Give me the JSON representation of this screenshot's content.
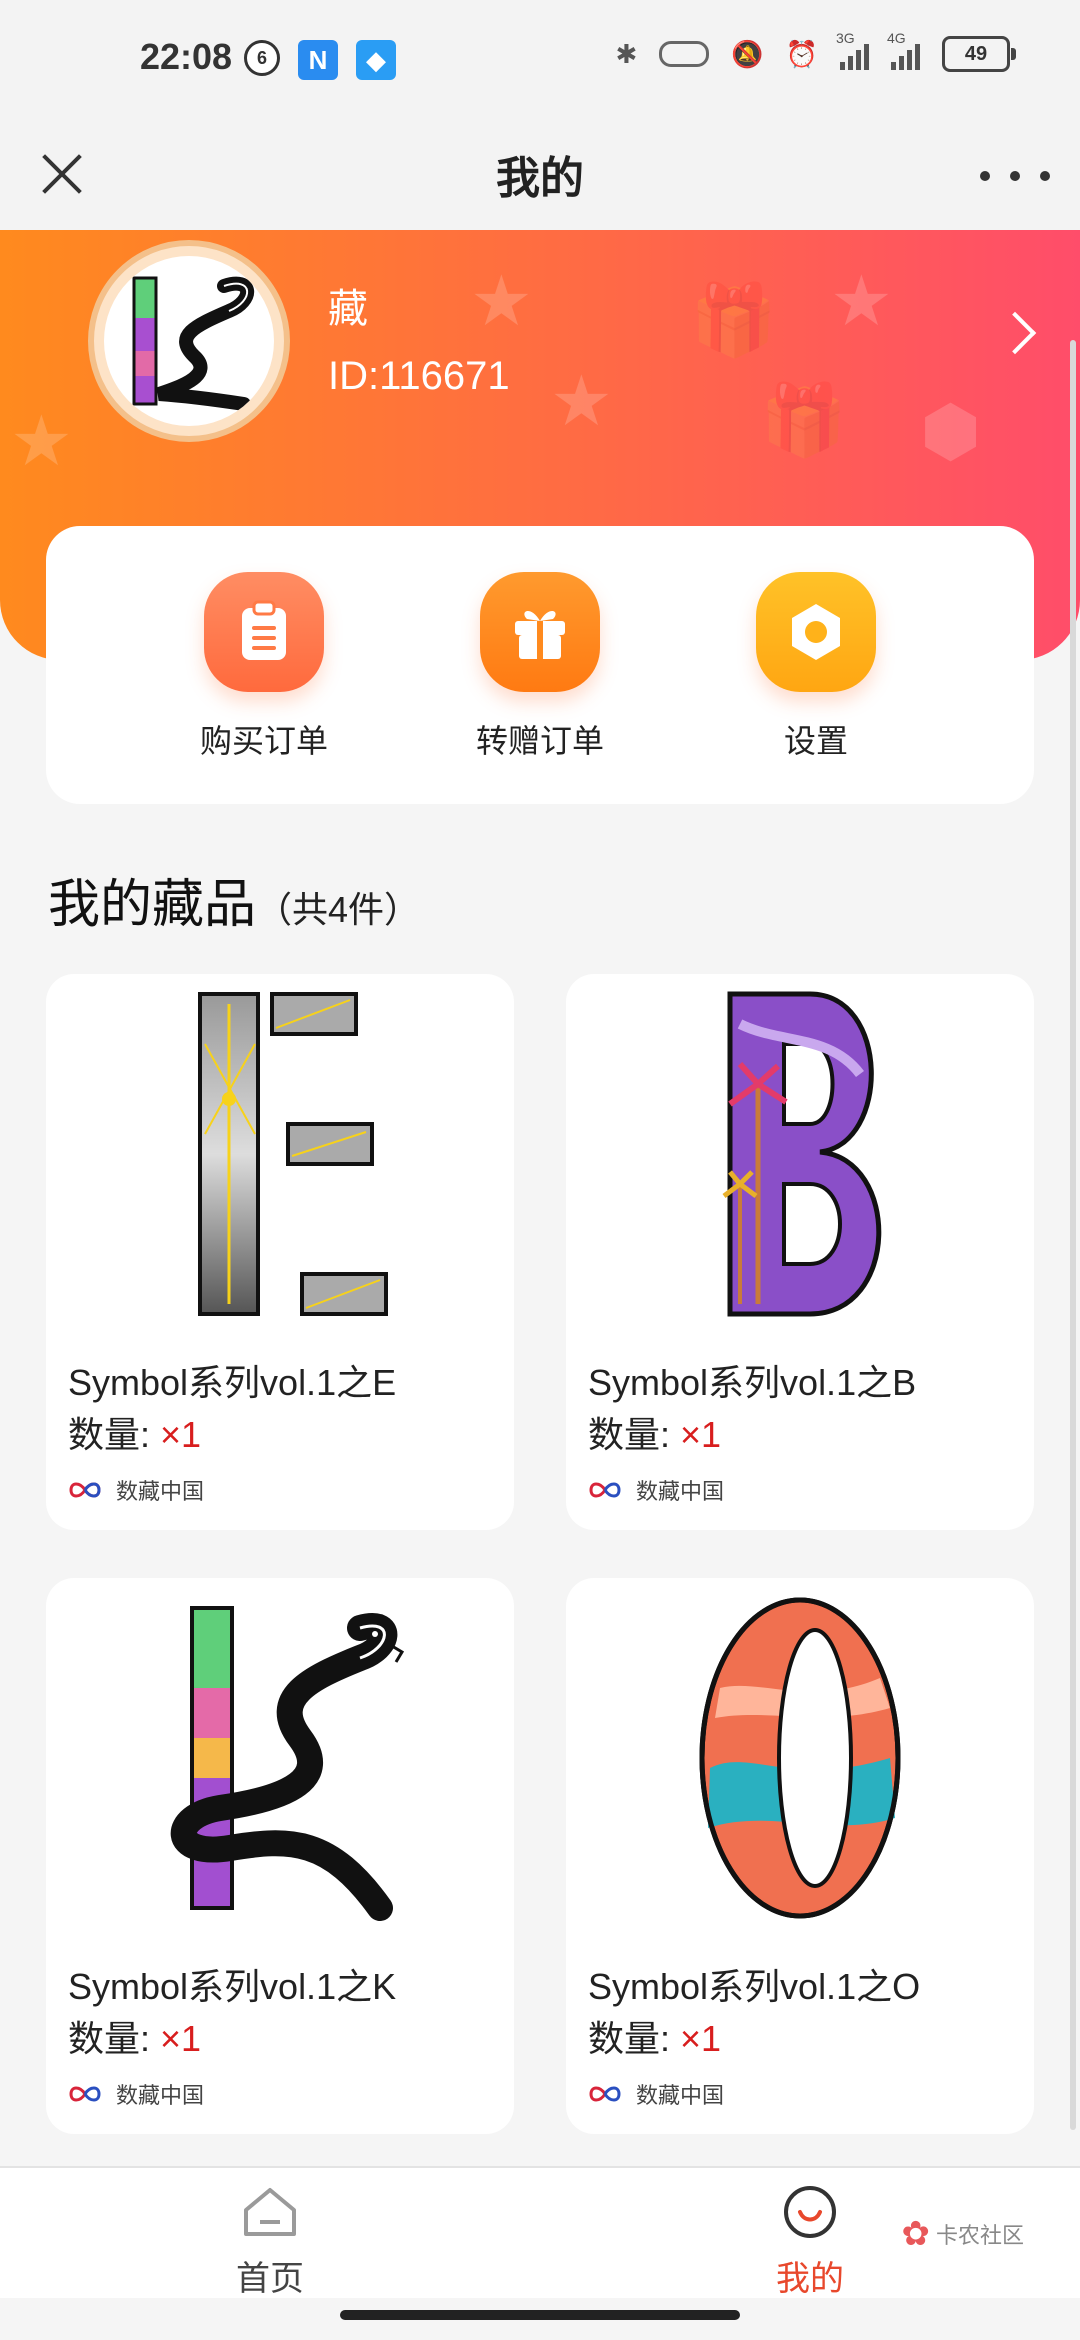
{
  "status": {
    "time": "22:08",
    "battery": "49",
    "net1": "3G",
    "net2": "4G"
  },
  "titlebar": {
    "title": "我的"
  },
  "profile": {
    "name": "藏",
    "id": "ID:116671"
  },
  "actions": [
    {
      "label": "购买订单",
      "icon": "clipboard-icon",
      "color": "#ff7a45"
    },
    {
      "label": "转赠订单",
      "icon": "gift-icon",
      "color": "#ff8a1e"
    },
    {
      "label": "设置",
      "icon": "hex-nut-icon",
      "color": "#ffb21a"
    }
  ],
  "collection": {
    "title": "我的藏品",
    "count": "（共4件）",
    "items": [
      {
        "name": "Symbol系列vol.1之E",
        "qty_label": "数量:",
        "qty": "×1",
        "brand": "数藏中国"
      },
      {
        "name": "Symbol系列vol.1之B",
        "qty_label": "数量:",
        "qty": "×1",
        "brand": "数藏中国"
      },
      {
        "name": "Symbol系列vol.1之K",
        "qty_label": "数量:",
        "qty": "×1",
        "brand": "数藏中国"
      },
      {
        "name": "Symbol系列vol.1之O",
        "qty_label": "数量:",
        "qty": "×1",
        "brand": "数藏中国"
      }
    ]
  },
  "nav": {
    "home": "首页",
    "mine": "我的",
    "active_color": "#e8482c",
    "watermark": "卡农社区"
  }
}
